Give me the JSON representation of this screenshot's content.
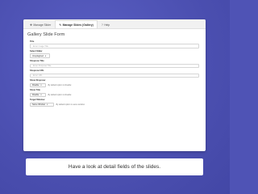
{
  "tabs": [
    {
      "icon": "✚",
      "label": "Manage Slider",
      "active": false
    },
    {
      "icon": "✎",
      "label": "Manage Slides (Gallery)",
      "active": true
    },
    {
      "icon": "?",
      "label": "Help",
      "active": false
    }
  ],
  "form": {
    "title": "Gallery Slide Form",
    "title_field": {
      "label": "Title",
      "placeholder": "Enter Image Title"
    },
    "select_slider": {
      "label": "Select Slider",
      "value": "Unsplugined"
    },
    "shopnow_title": {
      "label": "Shopnow Title",
      "placeholder": "Enter Shopnow Title"
    },
    "shopnow_url": {
      "label": "Shopnow URL",
      "placeholder": "Enter URL"
    },
    "show_shopnow": {
      "label": "Show Shopnow",
      "value": "Disable",
      "hint": "By default option is Disable"
    },
    "show_title": {
      "label": "Show Title",
      "value": "Disable",
      "hint": "By default option is Disable"
    },
    "target_window": {
      "label": "Target Window",
      "value": "Same Window",
      "hint": "By default option is same window"
    }
  },
  "caption": "Have a look at detail fields of the slides."
}
